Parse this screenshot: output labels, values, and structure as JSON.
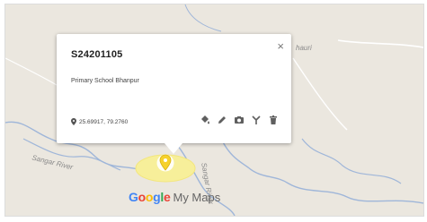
{
  "map": {
    "place_label_top": "hauri",
    "river_left": "Sangar River",
    "river_center": "Sangar River",
    "brand_logo": "Google",
    "brand_product": "My Maps",
    "logo_colors": [
      "#4285F4",
      "#EA4335",
      "#FBBC05",
      "#4285F4",
      "#34A853",
      "#EA4335"
    ],
    "marker_color": "#f6d12b",
    "highlight_color": "#f7ef9a"
  },
  "popup": {
    "title": "S24201105",
    "close_icon": "×",
    "description": "Primary School Bhanpur",
    "coordinates": "25.69917, 79.2760",
    "tools": [
      "paint-bucket-icon",
      "pencil-icon",
      "camera-icon",
      "directions-icon",
      "trash-icon"
    ]
  }
}
